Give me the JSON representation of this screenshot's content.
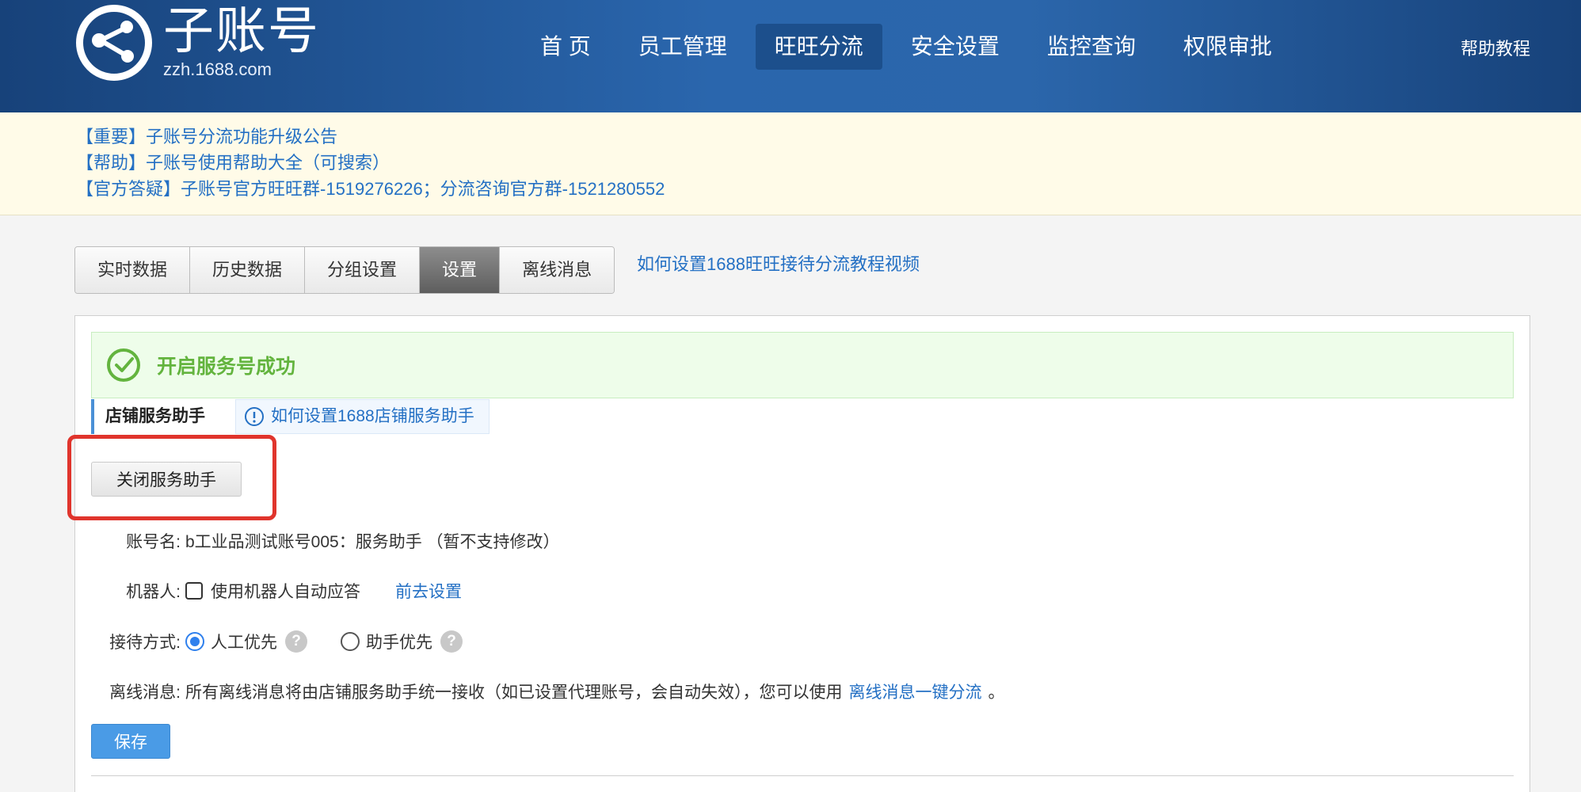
{
  "header": {
    "logo_title": "子账号",
    "logo_sub": "zzh.1688.com",
    "nav": [
      "首 页",
      "员工管理",
      "旺旺分流",
      "安全设置",
      "监控查询",
      "权限审批"
    ],
    "active_nav": "旺旺分流",
    "help": "帮助教程"
  },
  "notices": [
    "【重要】子账号分流功能升级公告",
    "【帮助】子账号使用帮助大全（可搜索）",
    "【官方答疑】子账号官方旺旺群-1519276226；分流咨询官方群-1521280552"
  ],
  "tabs": [
    "实时数据",
    "历史数据",
    "分组设置",
    "设置",
    "离线消息"
  ],
  "active_tab": "设置",
  "tab_link": "如何设置1688旺旺接待分流教程视频",
  "success_message": "开启服务号成功",
  "section": {
    "title": "店铺服务助手",
    "help_link": "如何设置1688店铺服务助手"
  },
  "close_button": "关闭服务助手",
  "account": {
    "label": "账号名:",
    "value": "b工业品测试账号005：服务助手 （暂不支持修改）"
  },
  "robot": {
    "label": "机器人:",
    "checkbox_label": "使用机器人自动应答",
    "checked": false,
    "link": "前去设置"
  },
  "reception": {
    "label": "接待方式:",
    "options": [
      "人工优先",
      "助手优先"
    ],
    "selected": "人工优先"
  },
  "offline": {
    "label": "离线消息:",
    "text": "所有离线消息将由店铺服务助手统一接收（如已设置代理账号，会自动失效），您可以使用",
    "link": "离线消息一键分流",
    "suffix": "。"
  },
  "save_button": "保存",
  "colors": {
    "header": "#2a66ad",
    "link": "#2470c4",
    "success": "#63b43e",
    "highlight": "#e0342c",
    "primary_button": "#4a9be6"
  }
}
